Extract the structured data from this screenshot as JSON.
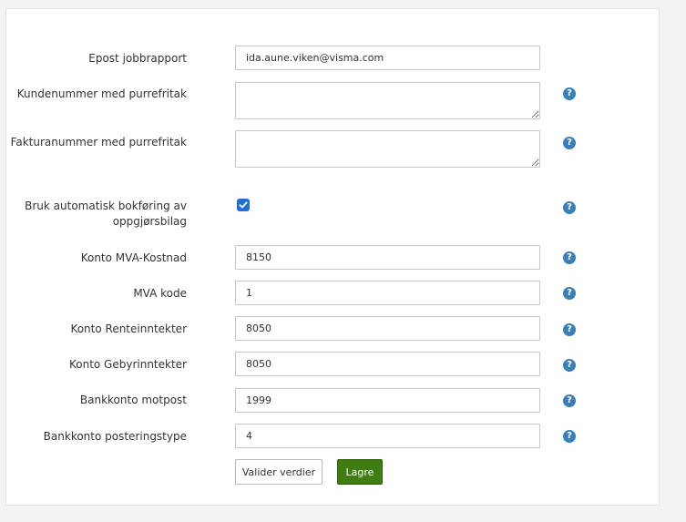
{
  "form": {
    "fields": [
      {
        "label": "Epost jobbrapport",
        "value": "ida.aune.viken@visma.com"
      },
      {
        "label": "Kundenummer med purrefritak",
        "value": ""
      },
      {
        "label": "Fakturanummer med purrefritak",
        "value": ""
      },
      {
        "label_line1": "Bruk automatisk bokføring av",
        "label_line2": "oppgjørsbilag",
        "checked": true
      },
      {
        "label": "Konto MVA-Kostnad",
        "value": "8150"
      },
      {
        "label": "MVA kode",
        "value": "1"
      },
      {
        "label": "Konto Renteinntekter",
        "value": "8050"
      },
      {
        "label": "Konto Gebyrinntekter",
        "value": "8050"
      },
      {
        "label": "Bankkonto motpost",
        "value": "1999"
      },
      {
        "label": "Bankkonto posteringstype",
        "value": "4"
      }
    ],
    "help_icon_glyph": "?",
    "buttons": {
      "validate_label": "Valider verdier",
      "save_label": "Lagre"
    }
  },
  "colors": {
    "help_icon": "#3a7fb8",
    "checkbox": "#1f6fd4",
    "save_button": "#3f7d12"
  }
}
